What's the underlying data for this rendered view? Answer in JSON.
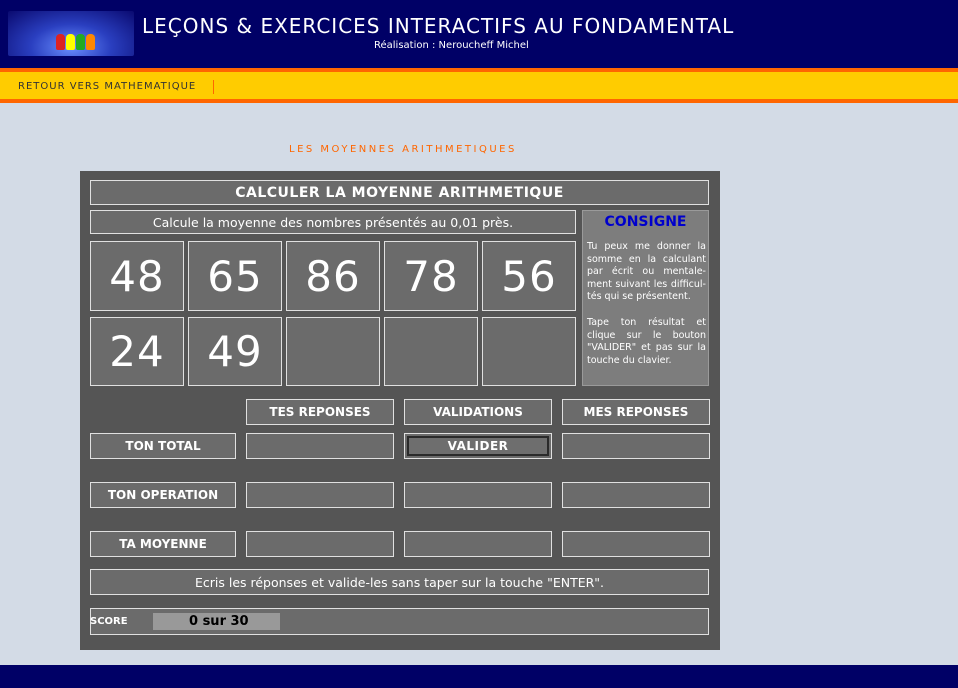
{
  "header": {
    "title": "LEÇONS & EXERCICES INTERACTIFS AU FONDAMENTAL",
    "subtitle": "Réalisation : Neroucheff Michel"
  },
  "nav": {
    "back_link": "RETOUR VERS MATHEMATIQUE"
  },
  "section_title": "LES MOYENNES ARITHMETIQUES",
  "exercise": {
    "heading": "CALCULER LA MOYENNE ARITHMETIQUE",
    "instruction": "Calcule la moyenne des nombres présentés au 0,01 près.",
    "numbers": [
      "48",
      "65",
      "86",
      "78",
      "56",
      "24",
      "49",
      "",
      "",
      ""
    ],
    "consigne_title": "CONSIGNE",
    "consigne_p1": "Tu peux me donner la somme en la calculant par écrit ou mentale-ment suivant les difficul-tés qui se présentent.",
    "consigne_p2": "Tape ton résultat et clique sur le bouton \"VALIDER\" et pas sur la touche du clavier.",
    "col_headers": {
      "tes_reponses": "TES REPONSES",
      "validations": "VALIDATIONS",
      "mes_reponses": "MES REPONSES"
    },
    "rows": {
      "total": "TON TOTAL",
      "operation": "TON OPERATION",
      "moyenne": "TA MOYENNE"
    },
    "validate_label": "VALIDER",
    "footer_note": "Ecris les réponses et valide-les sans taper sur la touche \"ENTER\".",
    "score_label": "SCORE",
    "score_value": "0  sur 30"
  }
}
